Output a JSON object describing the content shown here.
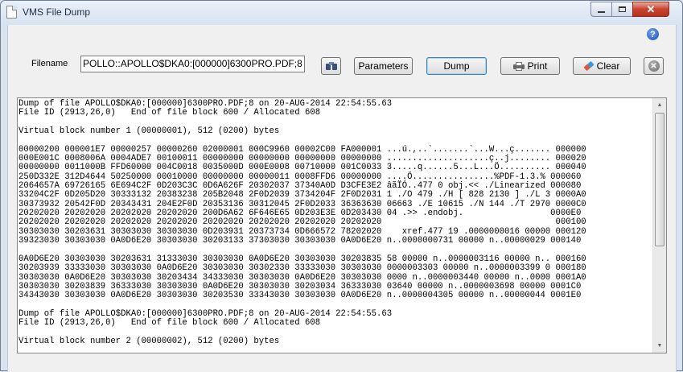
{
  "window": {
    "title": "VMS File Dump"
  },
  "toolbar": {
    "filename_label": "Filename",
    "filename_value": "POLLO::APOLLO$DKA0:[000000]6300PRO.PDF;8",
    "browse_icon": "binoculars-icon",
    "parameters_label": "Parameters",
    "dump_label": "Dump",
    "print_label": "Print",
    "clear_label": "Clear",
    "exit_icon": "close-circle-icon",
    "help_label": "?"
  },
  "output": {
    "lines": [
      "Dump of file APOLLO$DKA0:[000000]6300PRO.PDF;8 on 20-AUG-2014 22:54:55.63",
      "File ID (2913,26,0)   End of file block 600 / Allocated 608",
      "",
      "Virtual block number 1 (00000001), 512 (0200) bytes",
      "",
      "00000200 000001E7 00000257 00000260 02000001 000C9960 00002C00 FA000001 ...ú.,..`.......`...W...ç....... 000000",
      "000E001C 0008006A 0004ADE7 00100011 00000000 00000000 00000000 00000000 ....................ç..j........ 000020",
      "00000000 0011000B FFD60000 004C0018 0035000D 000E0008 00710000 001C0033 3.....q......5...L...Ö.......... 000040",
      "250D332E 312D4644 50250000 00010000 00000000 00000011 0008FFD6 00000000 ....Ö................%PDF-1.3.% 000060",
      "2064657A 69726165 6E694C2F 0D203C3C 0D6A626F 20302037 37340A0D D3CFE3E2 âãÏÓ..477 0 obj.<< ./Linearized 000080",
      "33204C2F 0D205D20 30333132 20383238 205B2048 2F0D2039 3734204F 2F0D2031 1 ./O 479 ./H [ 828 2130 ] ./L 3 0000A0",
      "30373932 20542F0D 20343431 204E2F0D 20353136 30312045 2F0D2033 36363630 06663 ./E 10615 ./N 144 ./T 2970 0000C0",
      "20202020 20202020 20202020 20202020 200D6A62 6F646E65 0D203E3E 0D203430 04 .>> .endobj.                 0000E0",
      "20202020 20202020 20202020 20202020 20202020 20202020 20202020 20202020                                  000100",
      "30303030 30203631 30303030 30303030 0D203931 20373734 0D666572 78202020    xref.477 19 .0000000016 00000 000120",
      "39323030 30303030 0A0D6E20 30303030 30203133 37303030 30303030 0A0D6E20 n..0000000731 00000 n..00000029 000140",
      "",
      "0A0D6E20 30303030 30203631 31333030 30303030 0A0D6E20 30303030 30203835 58 00000 n..0000003116 00000 n.. 000160",
      "30203939 33333030 30303030 0A0D6E20 30303030 30302330 33333030 30303030 0000003303 00000 n..0000003399 0 000180",
      "30303030 0A0D6E20 30303030 30203434 34333030 30303030 0A0D6E20 30303030 0000 n..0000003440 00000 n..0000 0001A0",
      "30303030 30203839 36333030 30303030 0A0D6E20 30303030 30203034 36333030 03640 00000 n..0000003698 00000 0001C0",
      "34343030 30303030 0A0D6E20 30303030 30203530 33343030 30303030 0A0D6E20 n..0000004305 00000 n..00000044 0001E0",
      "",
      "Dump of file APOLLO$DKA0:[000000]6300PRO.PDF;8 on 20-AUG-2014 22:54:55.63",
      "File ID (2913,26,0)   End of file block 600 / Allocated 608",
      "",
      "Virtual block number 2 (00000002), 512 (0200) bytes"
    ]
  }
}
